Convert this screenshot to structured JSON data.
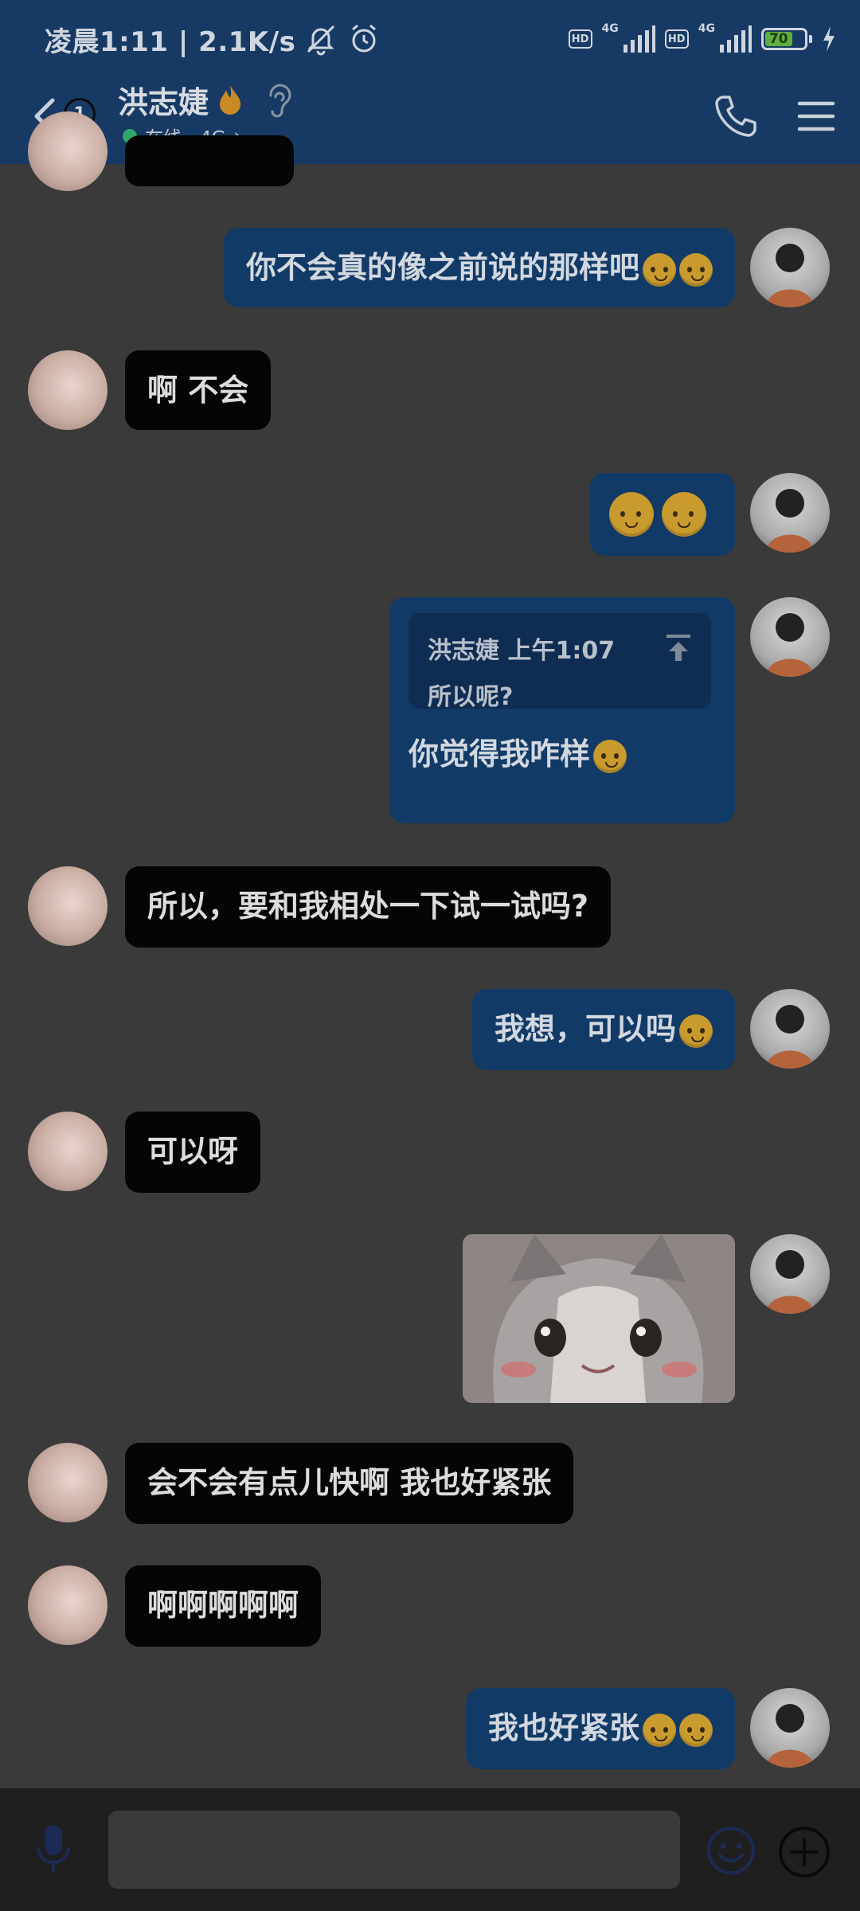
{
  "status_bar": {
    "time_speed": "凌晨1:11 | 2.1K/s",
    "hd1": "HD",
    "net1": "4G",
    "hd2": "HD",
    "net2": "4G",
    "battery": "70"
  },
  "header": {
    "unread_count": "1",
    "contact_name": "洪志婕",
    "status_text": "在线 - 4G",
    "status_chevron": "›"
  },
  "messages": [
    {
      "side": "out",
      "text": "你不会真的像之前说的那样吧",
      "emoji": [
        "slightly-sad-face",
        "slightly-sad-face"
      ]
    },
    {
      "side": "in",
      "text": "啊 不会"
    },
    {
      "side": "out",
      "text": "",
      "emoji": [
        "slightly-sad-face",
        "slightly-sad-face"
      ]
    },
    {
      "side": "out",
      "quote": {
        "author_time": "洪志婕 上午1:07",
        "text": "所以呢?"
      },
      "text": "你觉得我咋样",
      "emoji": [
        "slightly-sad-face"
      ]
    },
    {
      "side": "in",
      "text": "所以，要和我相处一下试一试吗?"
    },
    {
      "side": "out",
      "text": "我想，可以吗",
      "emoji": [
        "slightly-sad-face"
      ]
    },
    {
      "side": "in",
      "text": "可以呀"
    },
    {
      "side": "out",
      "sticker": "crying-cat-sticker"
    },
    {
      "side": "in",
      "text": "会不会有点儿快啊 我也好紧张"
    },
    {
      "side": "in",
      "text": "啊啊啊啊啊"
    },
    {
      "side": "out",
      "text": "我也好紧张",
      "emoji": [
        "slightly-sad-face",
        "slightly-sad-face"
      ]
    }
  ],
  "input": {
    "value": "",
    "placeholder": ""
  },
  "colors": {
    "header_bg": "#173a64",
    "chat_bg": "#3a3a3a",
    "incoming_bubble": "#050505",
    "outgoing_bubble": "#123a66",
    "online_dot": "#2fa66a",
    "battery_fill": "#5fae3f"
  },
  "icons": [
    "back-arrow-icon",
    "mute-bell-icon",
    "alarm-clock-icon",
    "signal-bars-icon",
    "charging-bolt-icon",
    "fire-icon",
    "ear-icon",
    "phone-icon",
    "menu-icon",
    "pin-top-icon",
    "voice-icon",
    "emoji-icon",
    "plus-icon"
  ]
}
